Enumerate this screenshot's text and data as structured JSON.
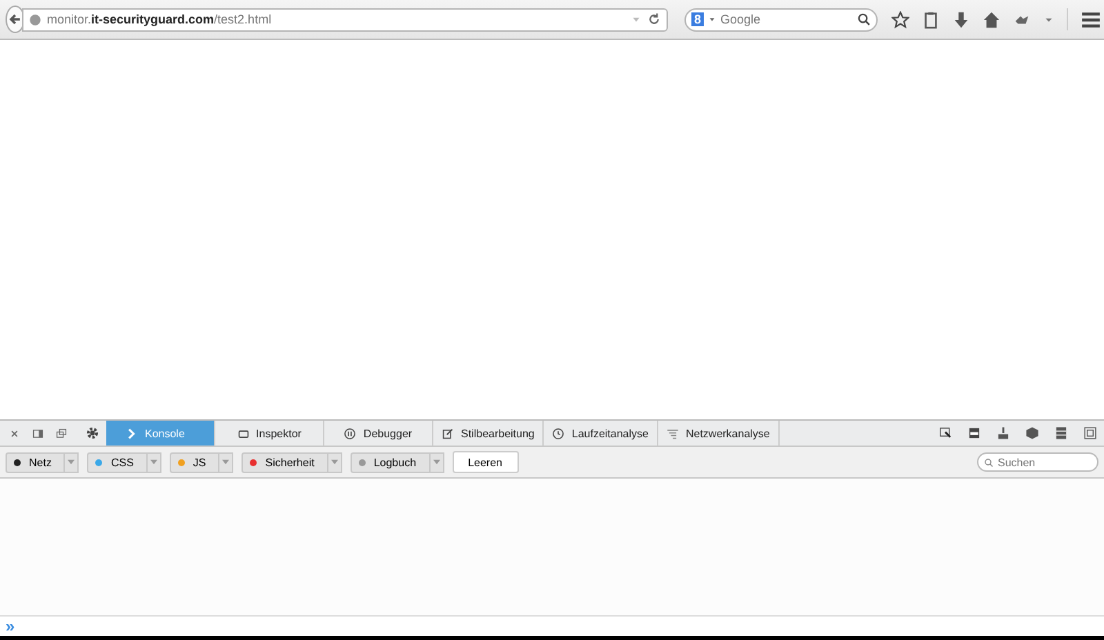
{
  "browser": {
    "url": "monitor.**it-securityguard.com**/test2.html",
    "search": {
      "engine_letter": "8",
      "placeholder": "Google"
    }
  },
  "devtools": {
    "tabs": [
      {
        "label": "Konsole",
        "selected": true
      },
      {
        "label": "Inspektor",
        "selected": false
      },
      {
        "label": "Debugger",
        "selected": false
      },
      {
        "label": "Stilbearbeitung",
        "selected": false
      },
      {
        "label": "Laufzeitanalyse",
        "selected": false
      },
      {
        "label": "Netzwerkanalyse",
        "selected": false
      }
    ],
    "filters": [
      {
        "label": "Netz",
        "color": "#222222"
      },
      {
        "label": "CSS",
        "color": "#3aa8e8"
      },
      {
        "label": "JS",
        "color": "#f0a020"
      },
      {
        "label": "Sicherheit",
        "color": "#e83030"
      },
      {
        "label": "Logbuch",
        "color": "#999999"
      }
    ],
    "clear_button": "Leeren",
    "search_placeholder": "Suchen",
    "prompt": "»"
  }
}
